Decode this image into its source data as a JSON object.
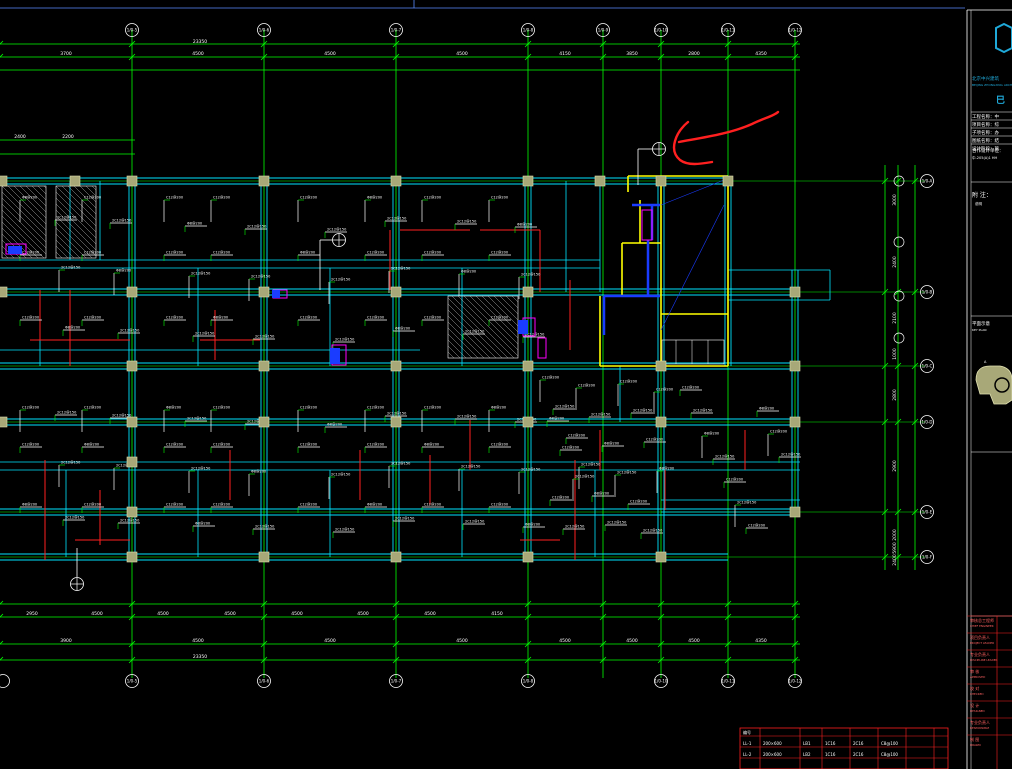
{
  "drawing": {
    "background": "#000000",
    "colors": {
      "axis": "#00ff00",
      "beam": "#00e5ff",
      "wall": "#ffff00",
      "column": "#a8a878",
      "rebar_red": "#ff2020",
      "slab_hatch": "#ffffff",
      "markup": "#ff2020",
      "highlight": "#ffff00",
      "blue_wall": "#1a3cff",
      "magenta": "#ff00ff",
      "titleblock_blue": "#1fa9d9"
    },
    "top_axis_labels": [
      "1/0-4",
      "1/0-5",
      "1/0-6",
      "1/0-7",
      "1/0-8",
      "1/0-9",
      "1/0-10",
      "1/0-11",
      "1/0-12",
      "1/0-13"
    ],
    "bottom_axis_labels": [
      "1/0-4",
      "1/0-5",
      "1/0-6",
      "1/0-7",
      "1/0-8",
      "1/0-9",
      "1/0-10",
      "1/0-11",
      "1/0-12",
      "1/0-13"
    ],
    "right_axis_labels": [
      "1/0-A",
      "1/0-B",
      "1/0-C",
      "1/0-D",
      "1/0-E",
      "1/0-F"
    ],
    "top_dims_overall": "23350",
    "top_dims_row1": [
      "3700",
      "4500",
      "4500",
      "4500",
      "4150",
      "3850",
      "2800",
      "4350"
    ],
    "top_dims_row2": [
      "2400",
      "2200"
    ],
    "bottom_dims_overall": "23350",
    "bottom_dims_row1": [
      "3900",
      "4500",
      "4500",
      "4500",
      "4500",
      "4500",
      "4500",
      "4350"
    ],
    "bottom_dims_row2": [
      "2950",
      "4500",
      "4500",
      "4500",
      "4500",
      "4500",
      "4500",
      "4150"
    ],
    "right_dims": [
      "3000",
      "2400",
      "2100",
      "1000",
      "2800",
      "2900",
      "2000",
      "5900",
      "2400",
      "900"
    ],
    "beam_label": "2C12@150",
    "beam_label_alt": "C12@200",
    "small_label": "Φ8@200"
  },
  "title_block": {
    "company": "北京中兴建筑",
    "company_sub": "BEIJING ZHONGXING ARCH DESIGN",
    "stamp_glyph": "巳",
    "rows": [
      "工程名称：中",
      "项目名称：综",
      "子项名称：办",
      "图纸名称：结",
      "设计阶段：施"
    ],
    "cert_label": "合作设计单位：",
    "cert_value": "中-205(A)1 HH",
    "note_label": "附  注：",
    "note_value": "说明",
    "keyplan_label": "平面示意",
    "keyplan_value": "KEY PLAN",
    "approval_rows": [
      "审核总工程师",
      "项目负责人",
      "专业负责人",
      "审    核",
      "校    对",
      "设    计",
      "专业负责人",
      "制    图"
    ],
    "approval_sub": [
      "CHIEF ENGINEER",
      "PROJECT LEADER",
      "DISCIPLINE LEADER",
      "APPROVED",
      "CHECKED",
      "DESIGNED",
      "RESPONSIBLE",
      "DRAWN"
    ]
  },
  "legend_table": {
    "header": "编号",
    "rows": [
      [
        "LL-1",
        "200×600",
        "LB1",
        "1C16",
        "2C16",
        "C8@100"
      ],
      [
        "LL-2",
        "200×600",
        "LB2",
        "1C16",
        "2C16",
        "C8@100"
      ],
      [
        "",
        "",
        "",
        "",
        "",
        ""
      ]
    ]
  }
}
